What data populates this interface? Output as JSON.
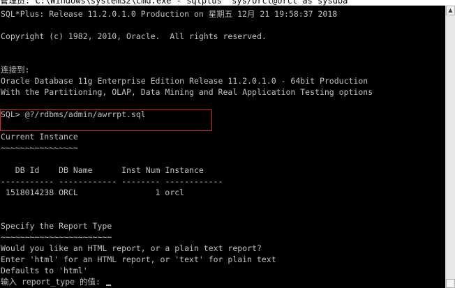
{
  "window": {
    "title": "管理员: C:\\Windows\\system32\\cmd.exe - sqlplus  sys/orcl@orcl as sysdba"
  },
  "console": {
    "lines": [
      "SQL*Plus: Release 11.2.0.1.0 Production on 星期五 12月 21 19:58:37 2018",
      "",
      "Copyright (c) 1982, 2010, Oracle.  All rights reserved.",
      "",
      "",
      "连接到:",
      "Oracle Database 11g Enterprise Edition Release 11.2.0.1.0 - 64bit Production",
      "With the Partitioning, OLAP, Data Mining and Real Application Testing options",
      "",
      "SQL> @?/rdbms/admin/awrrpt.sql",
      "",
      "Current Instance",
      "~~~~~~~~~~~~~~~~",
      "",
      "   DB Id    DB Name      Inst Num Instance",
      "----------- ------------ -------- ------------",
      " 1518014238 ORCL                1 orcl",
      "",
      "",
      "Specify the Report Type",
      "~~~~~~~~~~~~~~~~~~~~~~~",
      "Would you like an HTML report, or a plain text report?",
      "Enter 'html' for an HTML report, or 'text' for plain text",
      "Defaults to 'html'",
      "输入 report_type 的值: "
    ]
  },
  "scrollbar": {
    "up_arrow": "▲"
  }
}
